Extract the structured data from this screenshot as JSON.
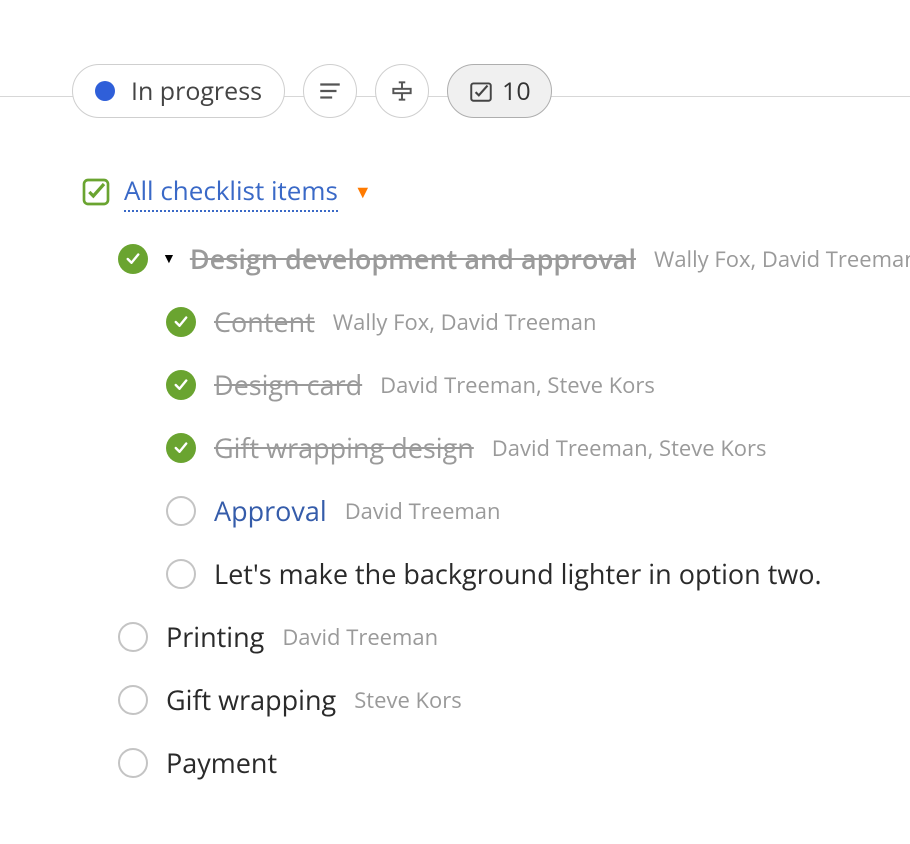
{
  "toolbar": {
    "status_label": "In progress",
    "checklist_count": "10"
  },
  "root": {
    "title": "All checklist items"
  },
  "items": [
    {
      "level": 1,
      "checked": true,
      "expandable": true,
      "title": "Design development and approval",
      "assignees": "Wally Fox, David Treeman",
      "style": "done-parent"
    },
    {
      "level": 2,
      "checked": true,
      "title": "Content",
      "assignees": "Wally Fox, David Treeman",
      "style": "done"
    },
    {
      "level": 2,
      "checked": true,
      "title": "Design card",
      "assignees": "David Treeman, Steve Kors",
      "style": "done"
    },
    {
      "level": 2,
      "checked": true,
      "title": "Gift wrapping design",
      "assignees": "David Treeman, Steve Kors",
      "style": "done"
    },
    {
      "level": 2,
      "checked": false,
      "title": "Approval",
      "assignees": "David Treeman",
      "style": "link"
    },
    {
      "level": 2,
      "checked": false,
      "title": "Let's make the background lighter in option two.",
      "assignees": "",
      "style": "plain"
    },
    {
      "level": 1,
      "checked": false,
      "title": "Printing",
      "assignees": "David Treeman",
      "style": "plain-big"
    },
    {
      "level": 1,
      "checked": false,
      "title": "Gift wrapping",
      "assignees": "Steve Kors",
      "style": "plain-big"
    },
    {
      "level": 1,
      "checked": false,
      "title": "Payment",
      "assignees": "",
      "style": "plain-big"
    }
  ]
}
